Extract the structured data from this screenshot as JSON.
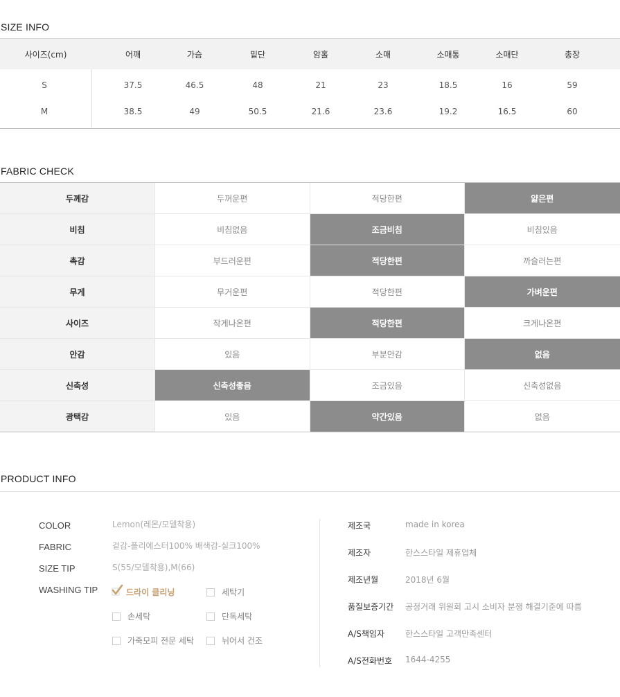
{
  "size_info": {
    "title": "SIZE INFO",
    "headers": [
      "사이즈(cm)",
      "어깨",
      "가슴",
      "밑단",
      "암홀",
      "소매",
      "소매통",
      "소매단",
      "총장"
    ],
    "rows": [
      [
        "S",
        "37.5",
        "46.5",
        "48",
        "21",
        "23",
        "18.5",
        "16",
        "59"
      ],
      [
        "M",
        "38.5",
        "49",
        "50.5",
        "21.6",
        "23.6",
        "19.2",
        "16.5",
        "60"
      ]
    ]
  },
  "fabric_check": {
    "title": "FABRIC CHECK",
    "selected_color": "#8c8c8c",
    "rows": [
      {
        "label": "두께감",
        "options": [
          "두꺼운편",
          "적당한편",
          "얇은편"
        ],
        "selected": 2
      },
      {
        "label": "비침",
        "options": [
          "비침없음",
          "조금비침",
          "비침있음"
        ],
        "selected": 1
      },
      {
        "label": "촉감",
        "options": [
          "부드러운편",
          "적당한편",
          "까슬러는편"
        ],
        "selected": 1
      },
      {
        "label": "무게",
        "options": [
          "무거운편",
          "적당한편",
          "가벼운편"
        ],
        "selected": 2
      },
      {
        "label": "사이즈",
        "options": [
          "작게나온편",
          "적당한편",
          "크게나온편"
        ],
        "selected": 1
      },
      {
        "label": "안감",
        "options": [
          "있음",
          "부분안감",
          "없음"
        ],
        "selected": 2
      },
      {
        "label": "신축성",
        "options": [
          "신축성좋음",
          "조금있음",
          "신축성없음"
        ],
        "selected": 0
      },
      {
        "label": "광택감",
        "options": [
          "있음",
          "약간있음",
          "없음"
        ],
        "selected": 1
      }
    ]
  },
  "product_info": {
    "title": "PRODUCT INFO",
    "color_label": "COLOR",
    "color_value": "Lemon(레몬/모델착용)",
    "fabric_label": "FABRIC",
    "fabric_value": "겉감-폴리에스터100% 배색감-실크100%",
    "sizetip_label": "SIZE TIP",
    "sizetip_value": "S(55/모델착용),M(66)",
    "washing_label": "WASHING TIP",
    "washing": [
      {
        "label": "드라이 클리닝",
        "checked": true
      },
      {
        "label": "세탁기",
        "checked": false
      },
      {
        "label": "손세탁",
        "checked": false
      },
      {
        "label": "단독세탁",
        "checked": false
      },
      {
        "label": "가죽모피 전문 세탁",
        "checked": false
      },
      {
        "label": "뉘어서 건조",
        "checked": false
      }
    ],
    "check_color": "#c9a072",
    "details": [
      {
        "label": "제조국",
        "value": "made in korea"
      },
      {
        "label": "제조자",
        "value": "한스스타일 제휴업체"
      },
      {
        "label": "제조년월",
        "value": "2018년 6월"
      },
      {
        "label": "품질보증기간",
        "value": "공정거래 위원회 고시 소비자 분쟁 해결기준에 따름"
      },
      {
        "label": "A/S책임자",
        "value": "한스스타일 고객만족센터"
      },
      {
        "label": "A/S전화번호",
        "value": "1644-4255"
      }
    ]
  }
}
